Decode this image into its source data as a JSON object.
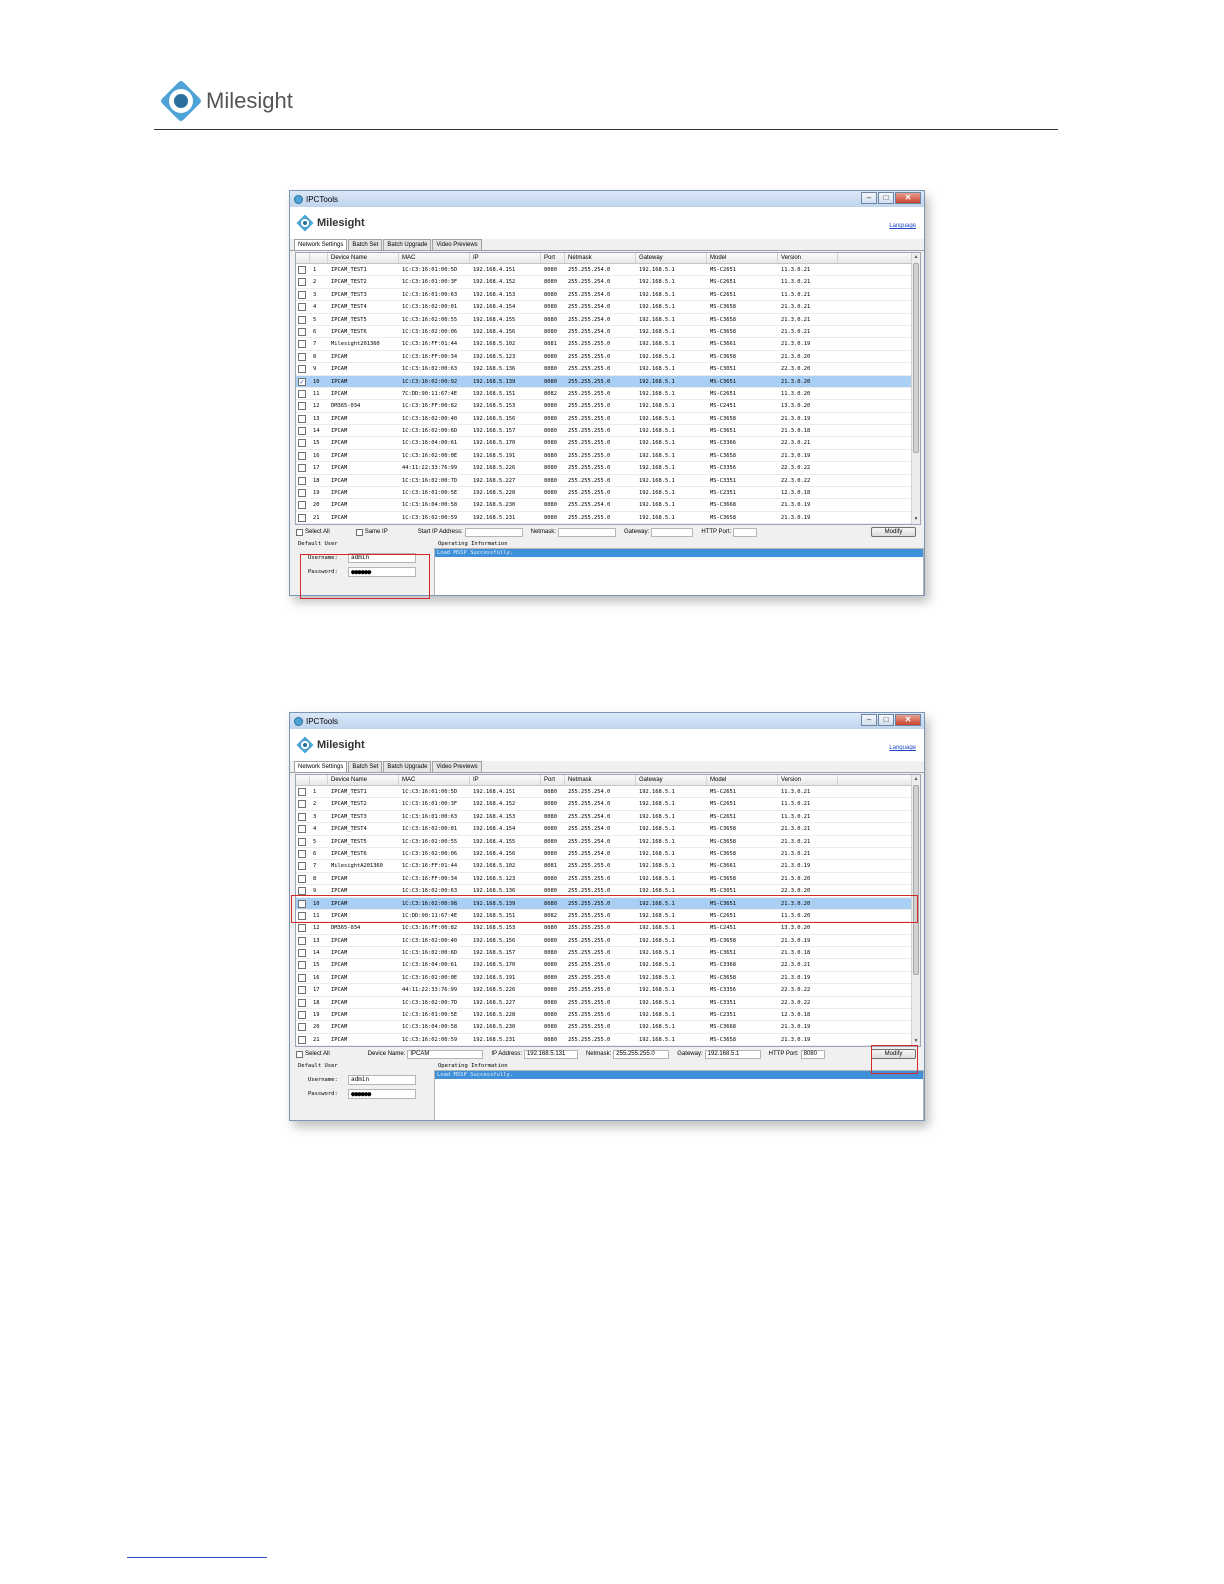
{
  "page": {
    "brand": "Milesight"
  },
  "window_common": {
    "title": "IPCTools",
    "brand": "Milesight",
    "language_link": "Language",
    "tabs": [
      "Network Settings",
      "Batch Set",
      "Batch Upgrade",
      "Video Previews"
    ],
    "columns": [
      "Device Name",
      "MAC",
      "IP",
      "Port",
      "Netmask",
      "Gateway",
      "Model",
      "Version"
    ],
    "select_all": "Select All",
    "modify": "Modify",
    "default_user": "Default User",
    "username_label": "Username:",
    "password_label": "Password:",
    "username": "admin",
    "password": "●●●●●●",
    "operating_info": "Operating Information",
    "log": "Load MSSP Successfully."
  },
  "shot1": {
    "selected_row": 10,
    "same_ip": "Same IP",
    "start_ip_label": "Start IP Address:",
    "netmask_label": "Netmask:",
    "gateway_label": "Gateway:",
    "http_port_label": "HTTP Port:",
    "rows": [
      [
        "1",
        "IPCAM_TEST1",
        "1C:C3:16:01:00:5D",
        "192.168.4.151",
        "8080",
        "255.255.254.0",
        "192.168.5.1",
        "MS-C2651",
        "11.3.0.21"
      ],
      [
        "2",
        "IPCAM_TEST2",
        "1C:C3:16:01:00:3F",
        "192.168.4.152",
        "8080",
        "255.255.254.0",
        "192.168.5.1",
        "MS-C2651",
        "11.3.0.21"
      ],
      [
        "3",
        "IPCAM_TEST3",
        "1C:C3:16:01:00:63",
        "192.168.4.153",
        "8080",
        "255.255.254.0",
        "192.168.5.1",
        "MS-C2651",
        "11.3.0.21"
      ],
      [
        "4",
        "IPCAM_TEST4",
        "1C:C3:16:02:00:01",
        "192.168.4.154",
        "8080",
        "255.255.254.0",
        "192.168.5.1",
        "MS-C3658",
        "21.3.0.21"
      ],
      [
        "5",
        "IPCAM_TEST5",
        "1C:C3:16:02:00:55",
        "192.168.4.155",
        "8080",
        "255.255.254.0",
        "192.168.5.1",
        "MS-C3658",
        "21.3.0.21"
      ],
      [
        "6",
        "IPCAM_TEST6",
        "1C:C3:16:02:00:06",
        "192.168.4.156",
        "8080",
        "255.255.254.0",
        "192.168.5.1",
        "MS-C3658",
        "21.3.0.21"
      ],
      [
        "7",
        "Milesight201360",
        "1C:C3:16:FF:01:44",
        "192.168.5.102",
        "8081",
        "255.255.255.0",
        "192.168.5.1",
        "MS-C3661",
        "21.3.0.19"
      ],
      [
        "8",
        "IPCAM",
        "1C:C3:16:FF:00:34",
        "192.168.5.123",
        "8080",
        "255.255.255.0",
        "192.168.5.1",
        "MS-C3658",
        "21.3.0.20"
      ],
      [
        "9",
        "IPCAM",
        "1C:C3:16:02:00:63",
        "192.168.5.136",
        "8080",
        "255.255.255.0",
        "192.168.5.1",
        "MS-C3051",
        "22.3.0.20"
      ],
      [
        "10",
        "IPCAM",
        "1C:C3:16:02:00:92",
        "192.168.5.139",
        "8080",
        "255.255.255.0",
        "192.168.5.1",
        "MS-C3651",
        "21.3.0.20"
      ],
      [
        "11",
        "IPCAM",
        "7C:DD:90:11:67:4E",
        "192.168.5.151",
        "8082",
        "255.255.255.0",
        "192.168.5.1",
        "MS-C2651",
        "11.3.0.20"
      ],
      [
        "12",
        "DM365-034",
        "1C:C3:16:FF:00:82",
        "192.168.5.153",
        "8080",
        "255.255.255.0",
        "192.168.5.1",
        "MS-C2451",
        "13.3.0.20"
      ],
      [
        "13",
        "IPCAM",
        "1C:C3:16:02:00:40",
        "192.168.5.156",
        "8080",
        "255.255.255.0",
        "192.168.5.1",
        "MS-C3658",
        "21.3.0.19"
      ],
      [
        "14",
        "IPCAM",
        "1C:C3:16:02:00:6D",
        "192.168.5.157",
        "8080",
        "255.255.255.0",
        "192.168.5.1",
        "MS-C3651",
        "21.3.0.18"
      ],
      [
        "15",
        "IPCAM",
        "1C:C3:16:04:00:61",
        "192.168.5.170",
        "8080",
        "255.255.255.0",
        "192.168.5.1",
        "MS-C3366",
        "22.3.0.21"
      ],
      [
        "16",
        "IPCAM",
        "1C:C3:16:02:00:0E",
        "192.168.5.191",
        "8080",
        "255.255.255.0",
        "192.168.5.1",
        "MS-C3658",
        "21.3.0.19"
      ],
      [
        "17",
        "IPCAM",
        "44:11:22:33:76:99",
        "192.168.5.226",
        "8080",
        "255.255.255.0",
        "192.168.5.1",
        "MS-C3356",
        "22.3.0.22"
      ],
      [
        "18",
        "IPCAM",
        "1C:C3:16:02:00:7D",
        "192.168.5.227",
        "8080",
        "255.255.255.0",
        "192.168.5.1",
        "MS-C3351",
        "22.3.0.22"
      ],
      [
        "19",
        "IPCAM",
        "1C:C3:16:01:00:5E",
        "192.168.5.228",
        "8080",
        "255.255.255.0",
        "192.168.5.1",
        "MS-C2351",
        "12.3.0.18"
      ],
      [
        "20",
        "IPCAM",
        "1C:C3:16:04:00:58",
        "192.168.5.230",
        "8080",
        "255.255.254.0",
        "192.168.5.1",
        "MS-C3668",
        "21.3.0.19"
      ],
      [
        "21",
        "IPCAM",
        "1C:C3:16:02:00:59",
        "192.168.5.231",
        "8080",
        "255.255.255.0",
        "192.168.5.1",
        "MS-C3658",
        "21.3.0.19"
      ]
    ]
  },
  "shot2": {
    "selected_row": 10,
    "device_name_label": "Device Name:",
    "device_name_value": "IPCAM",
    "ip_label": "IP Address:",
    "ip_value": "192.168.5.131",
    "netmask_label": "Netmask:",
    "netmask_value": "255.255.255.0",
    "gateway_label": "Gateway:",
    "gateway_value": "192.168.5.1",
    "http_port_label": "HTTP Port:",
    "http_port_value": "8080",
    "rows": [
      [
        "1",
        "IPCAM_TEST1",
        "1C:C3:16:01:00:5D",
        "192.168.4.151",
        "8080",
        "255.255.254.0",
        "192.168.5.1",
        "MS-C2651",
        "11.3.0.21"
      ],
      [
        "2",
        "IPCAM_TEST2",
        "1C:C3:16:01:00:3F",
        "192.168.4.152",
        "8080",
        "255.255.254.0",
        "192.168.5.1",
        "MS-C2651",
        "11.3.0.21"
      ],
      [
        "3",
        "IPCAM_TEST3",
        "1C:C3:16:01:00:63",
        "192.168.4.153",
        "8080",
        "255.255.254.0",
        "192.168.5.1",
        "MS-C2651",
        "11.3.0.21"
      ],
      [
        "4",
        "IPCAM_TEST4",
        "1C:C3:16:02:00:01",
        "192.168.4.154",
        "8080",
        "255.255.254.0",
        "192.168.5.1",
        "MS-C3658",
        "21.3.0.21"
      ],
      [
        "5",
        "IPCAM_TEST5",
        "1C:C3:16:02:00:55",
        "192.168.4.155",
        "8080",
        "255.255.254.0",
        "192.168.5.1",
        "MS-C3658",
        "21.3.0.21"
      ],
      [
        "6",
        "IPCAM_TEST6",
        "1C:C3:16:02:00:06",
        "192.168.4.156",
        "8080",
        "255.255.254.0",
        "192.168.5.1",
        "MS-C3658",
        "21.3.0.21"
      ],
      [
        "7",
        "MilesightA201360",
        "1C:C3:16:FF:01:44",
        "192.168.5.102",
        "8081",
        "255.255.255.0",
        "192.168.5.1",
        "MS-C3661",
        "21.3.0.19"
      ],
      [
        "8",
        "IPCAM",
        "1C:C3:16:FF:00:34",
        "192.168.5.123",
        "8080",
        "255.255.255.0",
        "192.168.5.1",
        "MS-C3658",
        "21.3.0.20"
      ],
      [
        "9",
        "IPCAM",
        "1C:C3:16:02:00:63",
        "192.168.5.136",
        "8080",
        "255.255.255.0",
        "192.168.5.1",
        "MS-C3051",
        "22.3.0.20"
      ],
      [
        "10",
        "IPCAM",
        "1C:C3:16:02:00:98",
        "192.168.5.139",
        "8080",
        "255.255.255.0",
        "192.168.5.1",
        "MS-C3651",
        "21.3.0.20"
      ],
      [
        "11",
        "IPCAM",
        "1C:DD:90:11:67:4E",
        "192.168.5.151",
        "8082",
        "255.255.255.0",
        "192.168.5.1",
        "MS-C2651",
        "11.3.0.20"
      ],
      [
        "12",
        "DM365-034",
        "1C:C3:16:FF:00:82",
        "192.168.5.153",
        "8080",
        "255.255.255.0",
        "192.168.5.1",
        "MS-C2451",
        "13.3.0.20"
      ],
      [
        "13",
        "IPCAM",
        "1C:C3:16:02:00:40",
        "192.168.5.156",
        "8080",
        "255.255.255.0",
        "192.168.5.1",
        "MS-C3658",
        "21.3.0.19"
      ],
      [
        "14",
        "IPCAM",
        "1C:C3:16:02:00:6D",
        "192.168.5.157",
        "8080",
        "255.255.255.0",
        "192.168.5.1",
        "MS-C3651",
        "21.3.0.18"
      ],
      [
        "15",
        "IPCAM",
        "1C:C3:16:04:00:61",
        "192.168.5.170",
        "8080",
        "255.255.255.0",
        "192.168.5.1",
        "MS-C3368",
        "22.3.0.21"
      ],
      [
        "16",
        "IPCAM",
        "1C:C3:16:02:00:0E",
        "192.168.5.191",
        "8080",
        "255.255.255.0",
        "192.168.5.1",
        "MS-C3658",
        "21.3.0.19"
      ],
      [
        "17",
        "IPCAM",
        "44:11:22:33:76:99",
        "192.168.5.226",
        "8080",
        "255.255.255.0",
        "192.168.5.1",
        "MS-C3356",
        "22.3.0.22"
      ],
      [
        "18",
        "IPCAM",
        "1C:C3:16:02:00:7D",
        "192.168.5.227",
        "8080",
        "255.255.255.0",
        "192.168.5.1",
        "MS-C3351",
        "22.3.0.22"
      ],
      [
        "19",
        "IPCAM",
        "1C:C3:16:01:00:5E",
        "192.168.5.228",
        "8080",
        "255.255.255.0",
        "192.168.5.1",
        "MS-C2351",
        "12.3.0.18"
      ],
      [
        "20",
        "IPCAM",
        "1C:C3:16:04:00:58",
        "192.168.5.230",
        "8080",
        "255.255.255.0",
        "192.168.5.1",
        "MS-C3668",
        "21.3.0.19"
      ],
      [
        "21",
        "IPCAM",
        "1C:C3:16:02:00:59",
        "192.168.5.231",
        "8080",
        "255.255.255.0",
        "192.168.5.1",
        "MS-C3658",
        "21.3.0.19"
      ]
    ]
  },
  "colors": {
    "selection": "#a9cff4",
    "highlight": "#d22a2a",
    "log_bar": "#3f8fd9",
    "link": "#1e48c8"
  }
}
